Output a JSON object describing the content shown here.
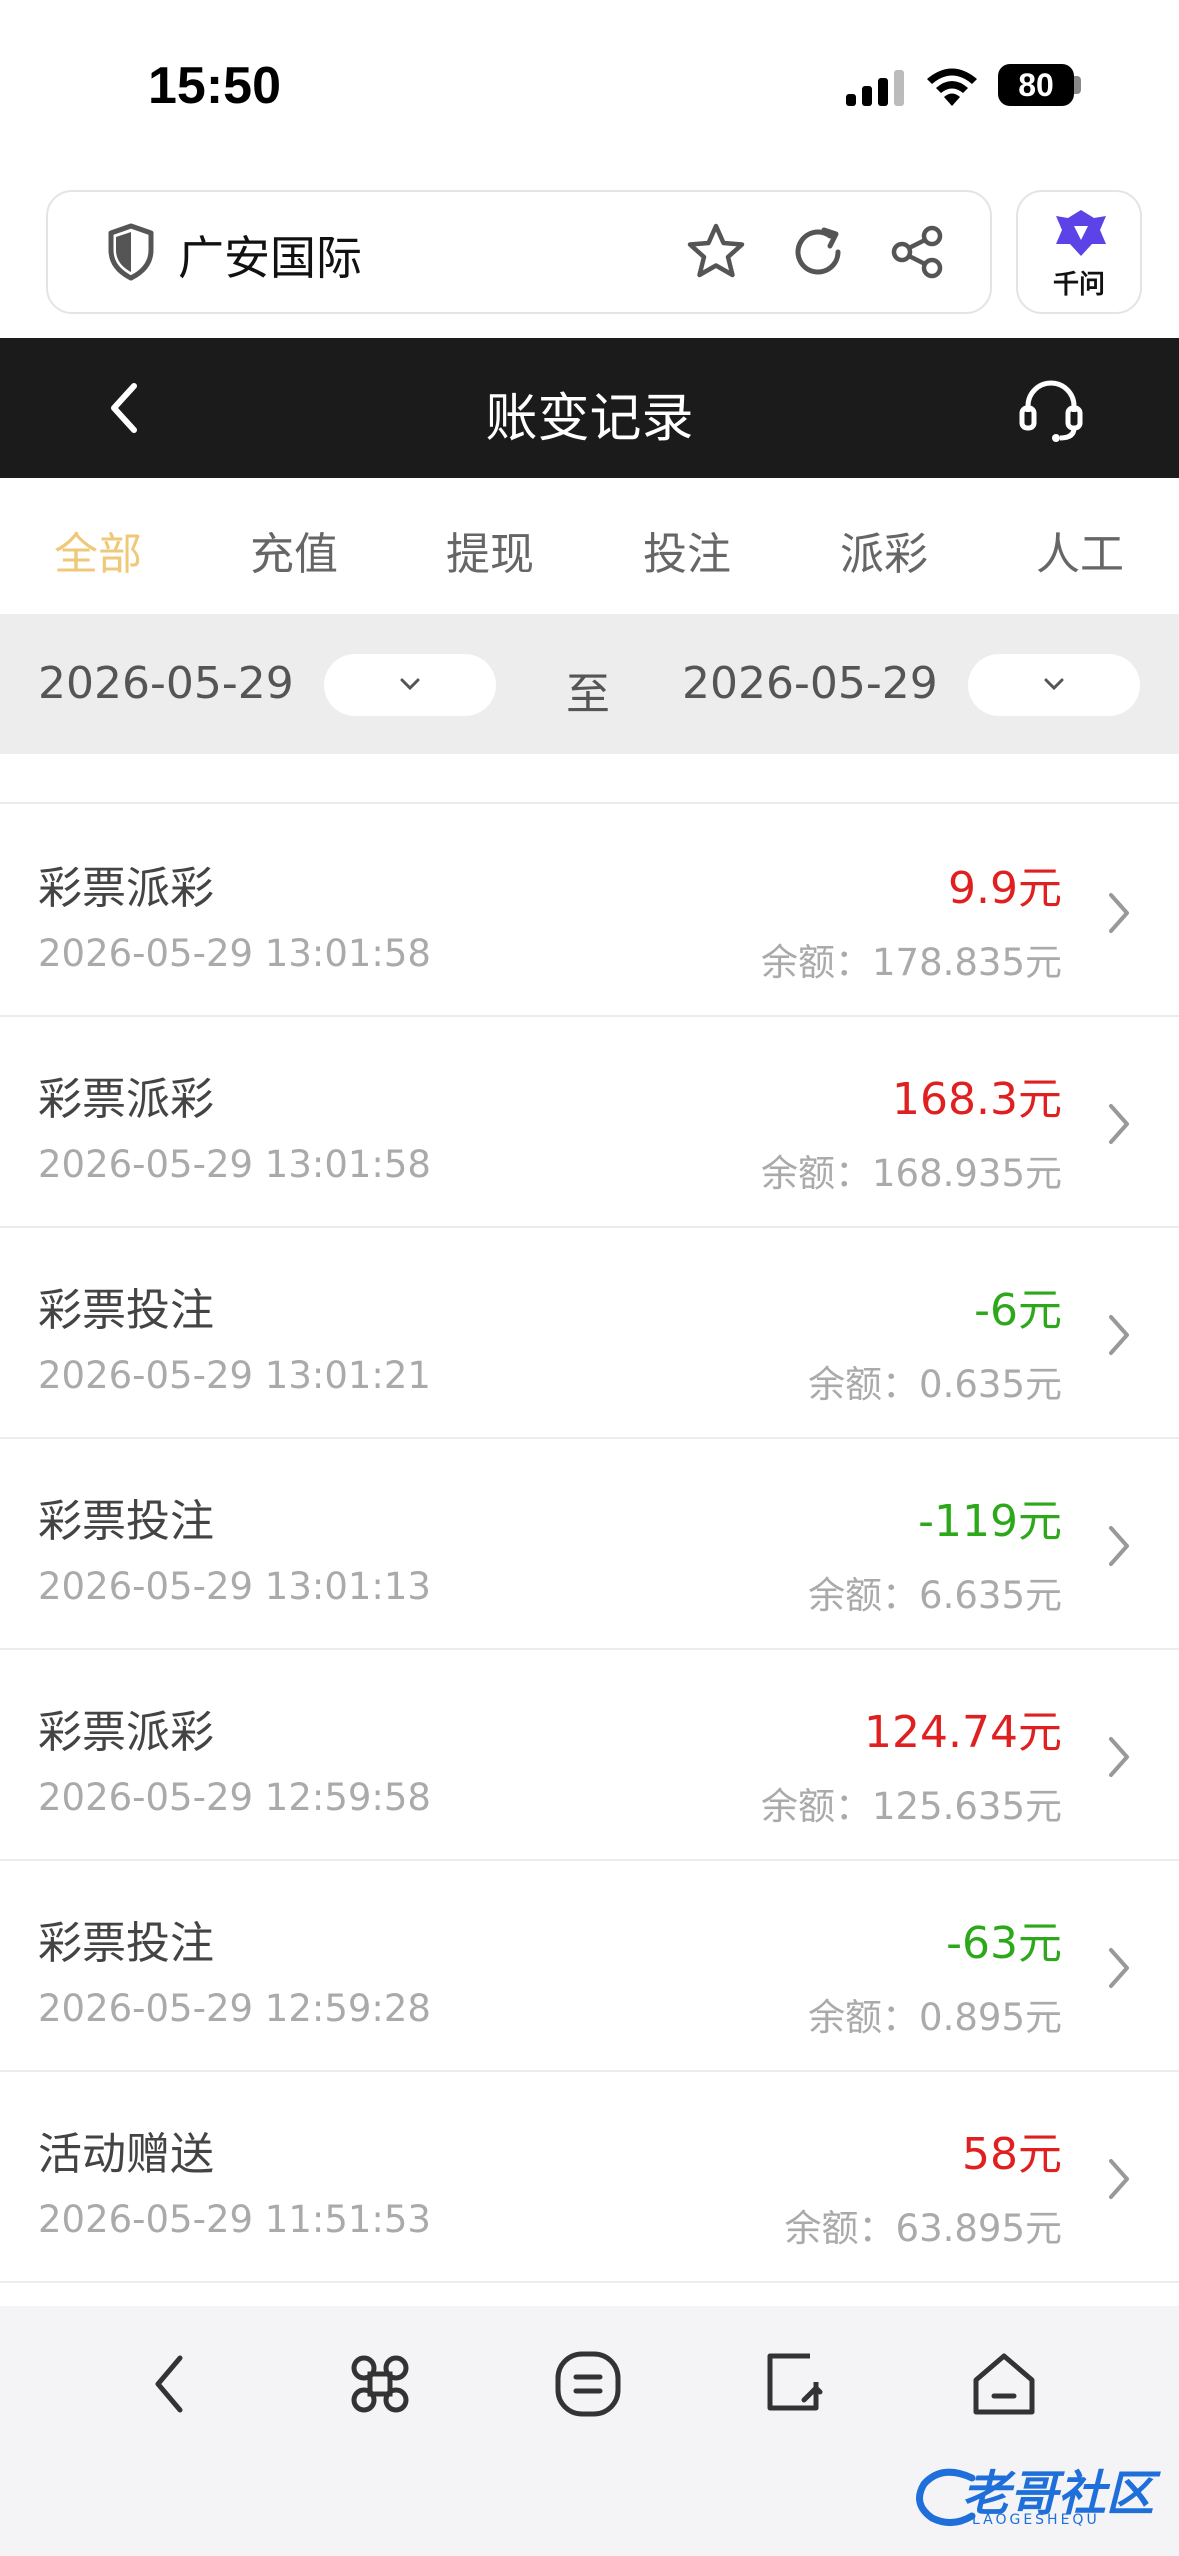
{
  "status_bar": {
    "time": "15:50",
    "battery": "80"
  },
  "browser": {
    "site_title": "广安国际",
    "assistant_label": "千问"
  },
  "header": {
    "title": "账变记录"
  },
  "tabs": [
    {
      "label": "全部",
      "active": true
    },
    {
      "label": "充值",
      "active": false
    },
    {
      "label": "提现",
      "active": false
    },
    {
      "label": "投注",
      "active": false
    },
    {
      "label": "派彩",
      "active": false
    },
    {
      "label": "人工",
      "active": false
    }
  ],
  "date_filter": {
    "start": "2026-05-29",
    "separator": "至",
    "end": "2026-05-29"
  },
  "records": [
    {
      "title": "彩票派彩",
      "time": "2026-05-29 13:01:58",
      "amount": "9.9元",
      "balance": "余额：178.835元",
      "type": "pos"
    },
    {
      "title": "彩票派彩",
      "time": "2026-05-29 13:01:58",
      "amount": "168.3元",
      "balance": "余额：168.935元",
      "type": "pos"
    },
    {
      "title": "彩票投注",
      "time": "2026-05-29 13:01:21",
      "amount": "-6元",
      "balance": "余额：0.635元",
      "type": "neg"
    },
    {
      "title": "彩票投注",
      "time": "2026-05-29 13:01:13",
      "amount": "-119元",
      "balance": "余额：6.635元",
      "type": "neg"
    },
    {
      "title": "彩票派彩",
      "time": "2026-05-29 12:59:58",
      "amount": "124.74元",
      "balance": "余额：125.635元",
      "type": "pos"
    },
    {
      "title": "彩票投注",
      "time": "2026-05-29 12:59:28",
      "amount": "-63元",
      "balance": "余额：0.895元",
      "type": "neg"
    },
    {
      "title": "活动赠送",
      "time": "2026-05-29 11:51:53",
      "amount": "58元",
      "balance": "余额：63.895元",
      "type": "pos"
    }
  ],
  "colors": {
    "positive": "#e02020",
    "negative": "#2ea81b",
    "active_tab": "#f0c879",
    "header_bg": "#1b1b1b"
  },
  "icons": {
    "url_bar": [
      "shield-icon",
      "star-icon",
      "reload-icon",
      "share-icon"
    ],
    "toolbar": [
      "back-icon",
      "command-icon",
      "menu-icon",
      "tabs-icon",
      "home-icon"
    ]
  },
  "watermark": {
    "text": "老哥社区",
    "sub": "LAOGESHEQU"
  }
}
